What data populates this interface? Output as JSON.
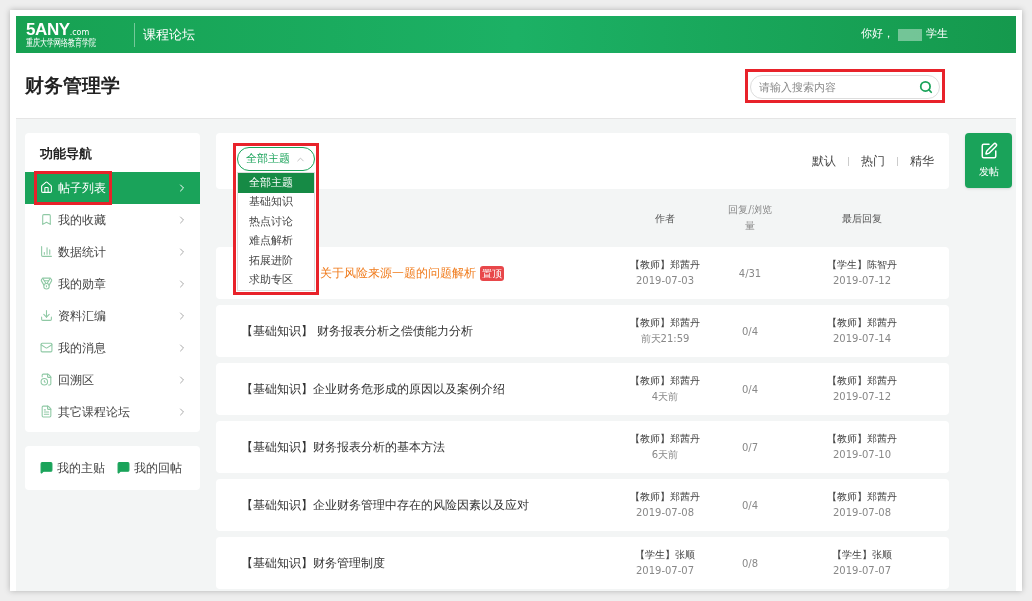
{
  "header": {
    "logo": "5ANY",
    "logo_suffix": ".com",
    "logo_subtitle": "重庆大学网络教育学院",
    "section": "课程论坛",
    "greeting": "你好，",
    "role": "学生"
  },
  "course_title": "财务管理学",
  "search": {
    "placeholder": "请输入搜索内容",
    "highlighted": true
  },
  "sidebar": {
    "title": "功能导航",
    "items": [
      {
        "label": "帖子列表",
        "selected": true,
        "highlighted": true
      },
      {
        "label": "我的收藏",
        "selected": false,
        "highlighted": false
      },
      {
        "label": "数据统计",
        "selected": false,
        "highlighted": false
      },
      {
        "label": "我的勋章",
        "selected": false,
        "highlighted": false
      },
      {
        "label": "资料汇编",
        "selected": false,
        "highlighted": false
      },
      {
        "label": "我的消息",
        "selected": false,
        "highlighted": false
      },
      {
        "label": "回溯区",
        "selected": false,
        "highlighted": false
      },
      {
        "label": "其它课程论坛",
        "selected": false,
        "highlighted": false
      }
    ],
    "links": [
      "我的主贴",
      "我的回帖"
    ]
  },
  "filter": {
    "label": "全部主题",
    "expanded": true,
    "highlighted": true,
    "options": [
      {
        "label": "全部主题",
        "selected": true
      },
      {
        "label": "基础知识",
        "selected": false
      },
      {
        "label": "热点讨论",
        "selected": false
      },
      {
        "label": "难点解析",
        "selected": false
      },
      {
        "label": "拓展进阶",
        "selected": false
      },
      {
        "label": "求助专区",
        "selected": false
      }
    ]
  },
  "sort_options": [
    "默认",
    "热门",
    "精华"
  ],
  "post_button": "发帖",
  "columns": [
    "作者",
    "回复/浏览量",
    "最后回复"
  ],
  "posts": [
    {
      "title": "关于风险来源一题的问题解析",
      "pinned": true,
      "badge": "置顶",
      "author": "【教师】郑茜丹",
      "author_time": "2019-07-03",
      "counts": "4/31",
      "last_reply": "【学生】陈智丹",
      "last_time": "2019-07-12"
    },
    {
      "title": "【基础知识】 财务报表分析之偿债能力分析",
      "pinned": false,
      "author": "【教师】郑茜丹",
      "author_time": "前天21:59",
      "counts": "0/4",
      "last_reply": "【教师】郑茜丹",
      "last_time": "2019-07-14"
    },
    {
      "title": "【基础知识】企业财务危形成的原因以及案例介绍",
      "pinned": false,
      "author": "【教师】郑茜丹",
      "author_time": "4天前",
      "counts": "0/4",
      "last_reply": "【教师】郑茜丹",
      "last_time": "2019-07-12"
    },
    {
      "title": "【基础知识】财务报表分析的基本方法",
      "pinned": false,
      "author": "【教师】郑茜丹",
      "author_time": "6天前",
      "counts": "0/7",
      "last_reply": "【教师】郑茜丹",
      "last_time": "2019-07-10"
    },
    {
      "title": "【基础知识】企业财务管理中存在的风险因素以及应对",
      "pinned": false,
      "author": "【教师】郑茜丹",
      "author_time": "2019-07-08",
      "counts": "0/4",
      "last_reply": "【教师】郑茜丹",
      "last_time": "2019-07-08"
    },
    {
      "title": "【基础知识】财务管理制度",
      "pinned": false,
      "author": "【学生】张顺",
      "author_time": "2019-07-07",
      "counts": "0/8",
      "last_reply": "【学生】张顺",
      "last_time": "2019-07-07"
    }
  ]
}
